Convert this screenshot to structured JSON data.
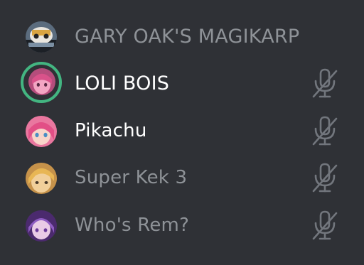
{
  "channel_members": [
    {
      "name": "GARY OAK'S MAGIKARP",
      "avatar": "magikarp-avatar",
      "speaking": false,
      "highlighted": false,
      "mic_icon": null
    },
    {
      "name": "LOLI BOIS",
      "avatar": "pink-hair-avatar",
      "speaking": true,
      "highlighted": true,
      "mic_icon": "mic-muted-icon"
    },
    {
      "name": "Pikachu",
      "avatar": "pink-anime-avatar",
      "speaking": false,
      "highlighted": true,
      "mic_icon": "mic-muted-icon"
    },
    {
      "name": "Super Kek 3",
      "avatar": "blond-anime-avatar",
      "speaking": false,
      "highlighted": false,
      "mic_icon": "mic-muted-icon"
    },
    {
      "name": "Who's Rem?",
      "avatar": "purple-anime-avatar",
      "speaking": false,
      "highlighted": false,
      "mic_icon": "mic-muted-icon"
    }
  ],
  "colors": {
    "background": "#2f3136",
    "speaking_ring": "#43b581",
    "dim_text": "#8e9297",
    "bright_text": "#ffffff",
    "icon": "#72767d"
  }
}
